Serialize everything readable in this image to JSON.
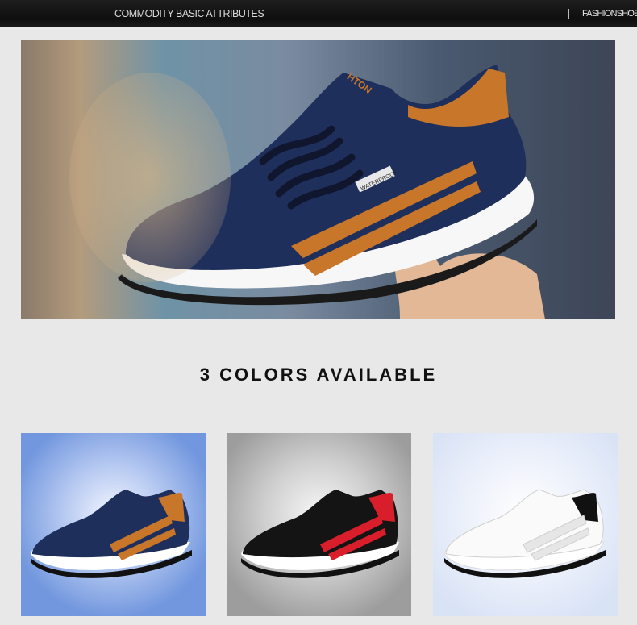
{
  "header": {
    "title": "COMMODITY BASIC ATTRIBUTES",
    "brand": "FASHIONSHOES"
  },
  "hero": {
    "tongue_logo": "HTON",
    "tag": "WATERPROOF"
  },
  "section": {
    "heading": "3 COLORS AVAILABLE"
  },
  "colors": {
    "blue": {
      "upper": "#1f2f5c",
      "accent": "#c8762a",
      "collar": "#c8762a"
    },
    "black": {
      "upper": "#141414",
      "accent": "#d81e2a",
      "collar": "#d81e2a"
    },
    "white": {
      "upper": "#fafafa",
      "accent": "#e6e6e6",
      "collar": "#111111"
    }
  }
}
